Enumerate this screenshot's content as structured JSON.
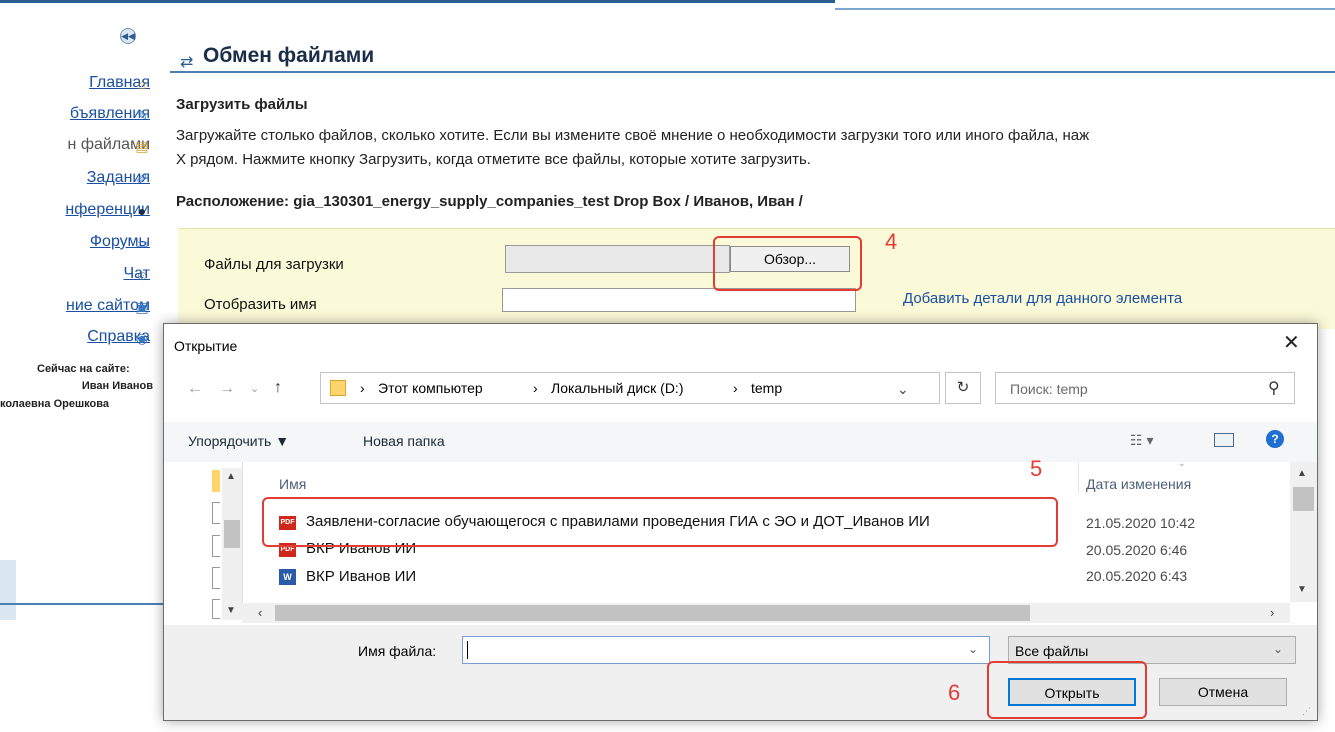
{
  "sidebar": {
    "items": [
      {
        "label": "Главная",
        "icon": "home-icon"
      },
      {
        "label": "бъявления",
        "icon": "announcements-icon"
      },
      {
        "label": "н файлами",
        "icon": "file-exchange-icon"
      },
      {
        "label": "Задания",
        "icon": "assignments-icon"
      },
      {
        "label": "нференции",
        "icon": "conference-icon"
      },
      {
        "label": "Форумы",
        "icon": "forums-icon"
      },
      {
        "label": "Чат",
        "icon": "chat-icon"
      },
      {
        "label": "ние сайтом",
        "icon": "site-admin-icon"
      },
      {
        "label": "Справка",
        "icon": "help-icon"
      }
    ],
    "online_title": "Сейчас на сайте:",
    "online_users": [
      "Иван Иванов",
      "колаевна Орешкова"
    ]
  },
  "page": {
    "title": "Обмен файлами",
    "section_title": "Загрузить файлы",
    "description_line1": "Загружайте столько файлов, сколько хотите. Если вы измените своё мнение о необходимости загрузки того или иного файла, наж",
    "description_line2": "X рядом. Нажмите кнопку Загрузить, когда отметите все файлы, которые хотите загрузить.",
    "location": "Расположение: gia_130301_energy_supply_companies_test Drop Box / Иванов, Иван /"
  },
  "form": {
    "files_label": "Файлы для загрузки",
    "browse_label": "Обзор...",
    "display_name_label": "Отобразить имя",
    "details_link": "Добавить детали для данного элемента"
  },
  "annotations": {
    "step4": "4",
    "step5": "5",
    "step6": "6"
  },
  "dialog": {
    "title": "Открытие",
    "close": "✕",
    "breadcrumbs": [
      "Этот компьютер",
      "Локальный диск (D:)",
      "temp"
    ],
    "search_placeholder": "Поиск: temp",
    "toolbar": {
      "organize": "Упорядочить ▼",
      "new_folder": "Новая папка"
    },
    "columns": {
      "name": "Имя",
      "date": "Дата изменения"
    },
    "files": [
      {
        "name": "Заявлени-согласие обучающегося с правилами проведения ГИА с ЭО и ДОТ_Иванов ИИ",
        "date": "21.05.2020 10:42",
        "type": "pdf"
      },
      {
        "name": "ВКР Иванов ИИ",
        "date": "20.05.2020 6:46",
        "type": "pdf"
      },
      {
        "name": "ВКР Иванов ИИ",
        "date": "20.05.2020 6:43",
        "type": "word"
      }
    ],
    "filename_label": "Имя файла:",
    "filter_value": "Все файлы",
    "open_button": "Открыть",
    "cancel_button": "Отмена"
  },
  "colors": {
    "accent": "#e23d35",
    "link": "#1a4fa3",
    "panel": "#fbfad8"
  }
}
